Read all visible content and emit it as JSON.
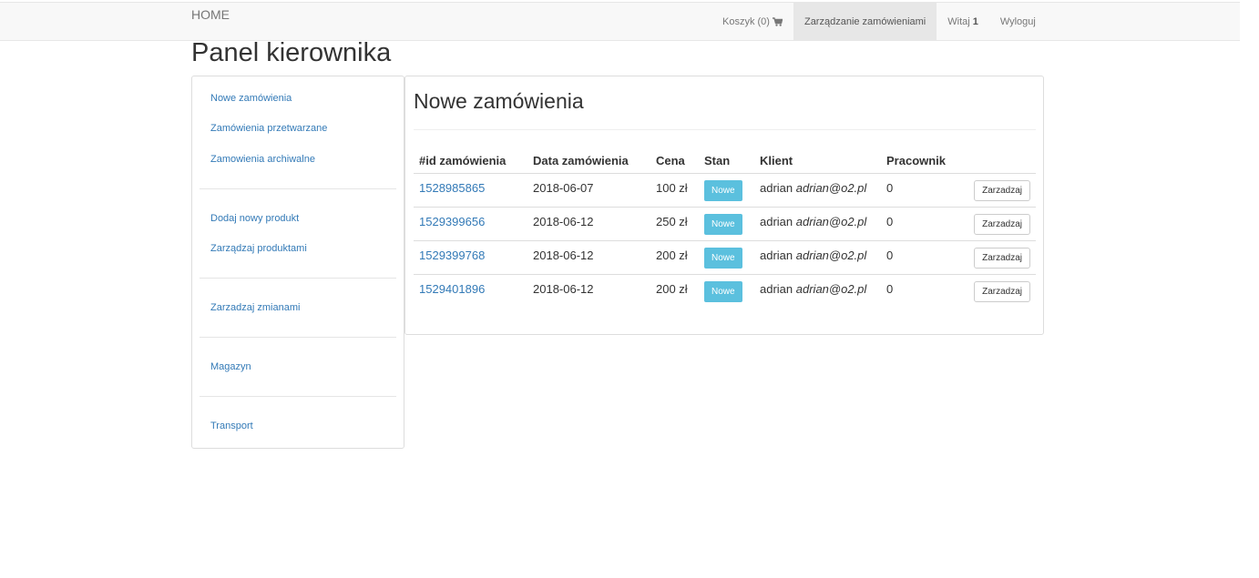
{
  "navbar": {
    "brand": "HOME",
    "cart_label": "Koszyk (0)",
    "manage_orders": "Zarządzanie zamówieniami",
    "greeting": "Witaj",
    "user_id": "1",
    "logout": "Wyloguj"
  },
  "page_title": "Panel kierownika",
  "sidebar": {
    "items": [
      "Nowe zamówienia",
      "Zamówienia przetwarzane",
      "Zamowienia archiwalne",
      "Dodaj nowy produkt",
      "Zarządzaj produktami",
      "Zarzadzaj zmianami",
      "Magazyn",
      "Transport"
    ]
  },
  "panel": {
    "title": "Nowe zamówienia",
    "columns": [
      "#id zamówienia",
      "Data zamówienia",
      "Cena",
      "Stan",
      "Klient",
      "Pracownik"
    ],
    "rows": [
      {
        "id": "1528985865",
        "date": "2018-06-07",
        "price": "100 zł",
        "status": "Nowe",
        "client_name": "adrian",
        "client_email": "adrian@o2.pl",
        "employee": "0",
        "action": "Zarzadzaj"
      },
      {
        "id": "1529399656",
        "date": "2018-06-12",
        "price": "250 zł",
        "status": "Nowe",
        "client_name": "adrian",
        "client_email": "adrian@o2.pl",
        "employee": "0",
        "action": "Zarzadzaj"
      },
      {
        "id": "1529399768",
        "date": "2018-06-12",
        "price": "200 zł",
        "status": "Nowe",
        "client_name": "adrian",
        "client_email": "adrian@o2.pl",
        "employee": "0",
        "action": "Zarzadzaj"
      },
      {
        "id": "1529401896",
        "date": "2018-06-12",
        "price": "200 zł",
        "status": "Nowe",
        "client_name": "adrian",
        "client_email": "adrian@o2.pl",
        "employee": "0",
        "action": "Zarzadzaj"
      }
    ]
  },
  "colors": {
    "link": "#337ab7",
    "badge": "#5bc0de",
    "navbar_bg": "#f8f8f8",
    "active_nav_bg": "#e7e7e7"
  },
  "icons": {
    "cart": "shopping-cart-icon"
  }
}
